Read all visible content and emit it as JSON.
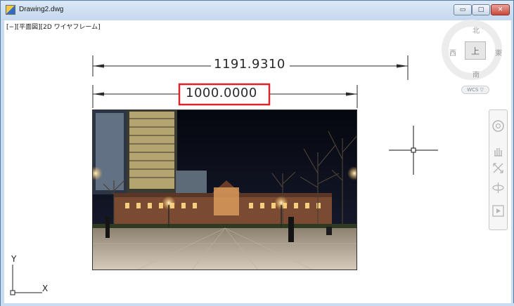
{
  "window": {
    "title": "Drawing2.dwg",
    "min_glyph": "▭",
    "max_glyph": "□",
    "close_glyph": "✕"
  },
  "viewport": {
    "label": "[−][平面図][2D ワイヤフレーム]"
  },
  "dimensions": {
    "outer_value": "1191.9310",
    "inner_value": "1000.0000",
    "highlight_color": "#d9262c"
  },
  "viewcube": {
    "north": "北",
    "south": "南",
    "east": "東",
    "west": "西",
    "top": "上",
    "wcs_label": "WCS ▽"
  },
  "ucs": {
    "x_label": "X",
    "y_label": "Y"
  },
  "icons": {
    "crosshair": "crosshair-cursor-icon",
    "steering_wheel": "steering-wheel-icon",
    "pan": "pan-hand-icon",
    "zoom": "zoom-extents-icon",
    "orbit": "orbit-icon",
    "showmotion": "showmotion-icon"
  }
}
